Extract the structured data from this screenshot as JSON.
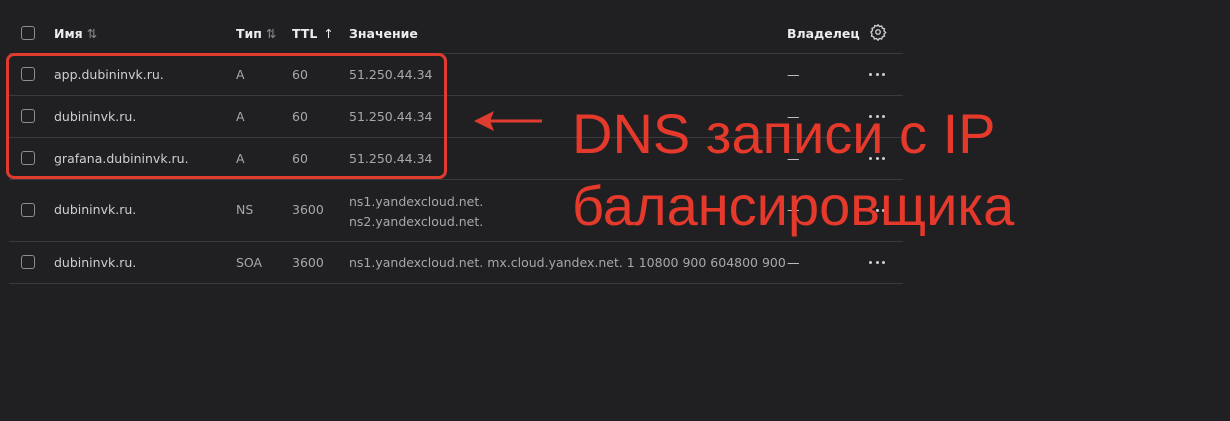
{
  "table": {
    "headers": {
      "name": "Имя",
      "type": "Тип",
      "ttl": "TTL",
      "value": "Значение",
      "owner": "Владелец"
    },
    "rows": [
      {
        "name": "app.dubininvk.ru.",
        "type": "A",
        "ttl": "60",
        "value": "51.250.44.34",
        "owner": "—"
      },
      {
        "name": "dubininvk.ru.",
        "type": "A",
        "ttl": "60",
        "value": "51.250.44.34",
        "owner": "—"
      },
      {
        "name": "grafana.dubininvk.ru.",
        "type": "A",
        "ttl": "60",
        "value": "51.250.44.34",
        "owner": "—"
      },
      {
        "name": "dubininvk.ru.",
        "type": "NS",
        "ttl": "3600",
        "value_lines": [
          "ns1.yandexcloud.net.",
          "ns2.yandexcloud.net."
        ],
        "owner": "—"
      },
      {
        "name": "dubininvk.ru.",
        "type": "SOA",
        "ttl": "3600",
        "value": "ns1.yandexcloud.net. mx.cloud.yandex.net. 1 10800 900 604800 900",
        "owner": "—"
      }
    ]
  },
  "annotation": {
    "line1": "DNS записи с IP",
    "line2": "балансировщика",
    "color": "#e5392c"
  },
  "icons": {
    "sort": "sort-arrows-icon",
    "sort_asc": "arrow-up-icon",
    "settings": "gear-icon",
    "menu": "more-dots-icon"
  }
}
